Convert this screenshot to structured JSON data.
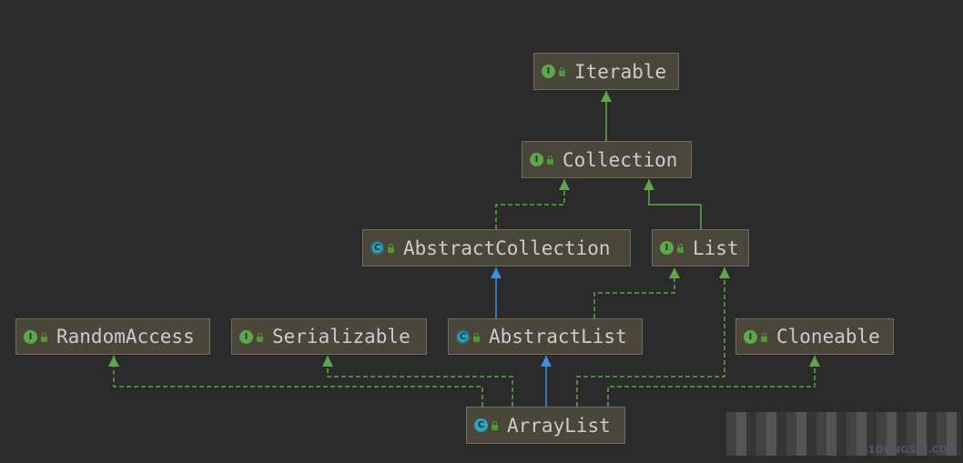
{
  "diagram": {
    "nodes": [
      {
        "id": "Iterable",
        "label": "Iterable",
        "kind": "interface",
        "icon_letter": "I"
      },
      {
        "id": "Collection",
        "label": "Collection",
        "kind": "interface",
        "icon_letter": "I"
      },
      {
        "id": "AbstractCollection",
        "label": "AbstractCollection",
        "kind": "abstract",
        "icon_letter": "C"
      },
      {
        "id": "List",
        "label": "List",
        "kind": "interface",
        "icon_letter": "I"
      },
      {
        "id": "RandomAccess",
        "label": "RandomAccess",
        "kind": "interface",
        "icon_letter": "I"
      },
      {
        "id": "Serializable",
        "label": "Serializable",
        "kind": "interface",
        "icon_letter": "I"
      },
      {
        "id": "AbstractList",
        "label": "AbstractList",
        "kind": "abstract",
        "icon_letter": "C"
      },
      {
        "id": "Cloneable",
        "label": "Cloneable",
        "kind": "interface",
        "icon_letter": "I"
      },
      {
        "id": "ArrayList",
        "label": "ArrayList",
        "kind": "class",
        "icon_letter": "C"
      }
    ],
    "edges": [
      {
        "from": "Collection",
        "to": "Iterable",
        "relation": "extends-interface"
      },
      {
        "from": "AbstractCollection",
        "to": "Collection",
        "relation": "implements"
      },
      {
        "from": "List",
        "to": "Collection",
        "relation": "extends-interface"
      },
      {
        "from": "AbstractList",
        "to": "AbstractCollection",
        "relation": "extends-class"
      },
      {
        "from": "AbstractList",
        "to": "List",
        "relation": "implements"
      },
      {
        "from": "ArrayList",
        "to": "AbstractList",
        "relation": "extends-class"
      },
      {
        "from": "ArrayList",
        "to": "RandomAccess",
        "relation": "implements"
      },
      {
        "from": "ArrayList",
        "to": "Serializable",
        "relation": "implements"
      },
      {
        "from": "ArrayList",
        "to": "List",
        "relation": "implements"
      },
      {
        "from": "ArrayList",
        "to": "Cloneable",
        "relation": "implements"
      }
    ],
    "colors": {
      "background": "#2b2b2b",
      "interface_edge": "#5fa74a",
      "class_edge": "#3d8fe0",
      "node_fill": "#4a473a"
    }
  },
  "watermark": "51DONGSHI.COM"
}
